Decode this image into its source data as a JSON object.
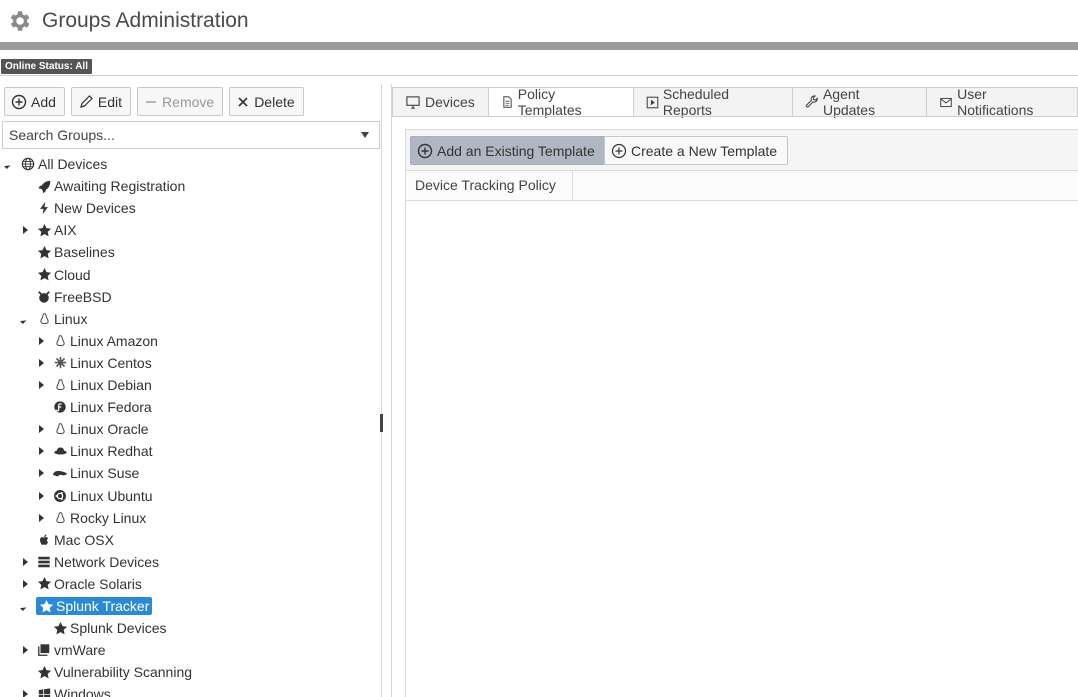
{
  "header": {
    "title": "Groups Administration",
    "icon": "gear-icon"
  },
  "status": {
    "badge": "Online Status: All"
  },
  "toolbar": {
    "add_label": "Add",
    "edit_label": "Edit",
    "remove_label": "Remove",
    "delete_label": "Delete"
  },
  "search": {
    "placeholder": "Search Groups..."
  },
  "tree": [
    {
      "label": "All Devices",
      "icon": "globe-icon",
      "level": 0,
      "expander": "down"
    },
    {
      "label": "Awaiting Registration",
      "icon": "rocket-icon",
      "level": 1,
      "expander": "none"
    },
    {
      "label": "New Devices",
      "icon": "bolt-icon",
      "level": 1,
      "expander": "none"
    },
    {
      "label": "AIX",
      "icon": "star-icon",
      "level": 1,
      "expander": "right"
    },
    {
      "label": "Baselines",
      "icon": "star-icon",
      "level": 1,
      "expander": "none"
    },
    {
      "label": "Cloud",
      "icon": "star-icon",
      "level": 1,
      "expander": "none"
    },
    {
      "label": "FreeBSD",
      "icon": "freebsd-icon",
      "level": 1,
      "expander": "none"
    },
    {
      "label": "Linux",
      "icon": "linux-icon",
      "level": 1,
      "expander": "down"
    },
    {
      "label": "Linux Amazon",
      "icon": "linux-icon",
      "level": 2,
      "expander": "right"
    },
    {
      "label": "Linux Centos",
      "icon": "centos-icon",
      "level": 2,
      "expander": "right"
    },
    {
      "label": "Linux Debian",
      "icon": "linux-icon",
      "level": 2,
      "expander": "right"
    },
    {
      "label": "Linux Fedora",
      "icon": "fedora-icon",
      "level": 2,
      "expander": "none"
    },
    {
      "label": "Linux Oracle",
      "icon": "linux-icon",
      "level": 2,
      "expander": "right"
    },
    {
      "label": "Linux Redhat",
      "icon": "redhat-icon",
      "level": 2,
      "expander": "right"
    },
    {
      "label": "Linux Suse",
      "icon": "suse-icon",
      "level": 2,
      "expander": "right"
    },
    {
      "label": "Linux Ubuntu",
      "icon": "ubuntu-icon",
      "level": 2,
      "expander": "right"
    },
    {
      "label": "Rocky Linux",
      "icon": "linux-icon",
      "level": 2,
      "expander": "right"
    },
    {
      "label": "Mac OSX",
      "icon": "apple-icon",
      "level": 1,
      "expander": "none"
    },
    {
      "label": "Network Devices",
      "icon": "server-icon",
      "level": 1,
      "expander": "right"
    },
    {
      "label": "Oracle Solaris",
      "icon": "star-icon",
      "level": 1,
      "expander": "right"
    },
    {
      "label": "Splunk Tracker",
      "icon": "star-icon",
      "level": 1,
      "expander": "down",
      "selected": true
    },
    {
      "label": "Splunk Devices",
      "icon": "star-icon",
      "level": 2,
      "expander": "none"
    },
    {
      "label": "vmWare",
      "icon": "vmware-icon",
      "level": 1,
      "expander": "right"
    },
    {
      "label": "Vulnerability Scanning",
      "icon": "star-icon",
      "level": 1,
      "expander": "none"
    },
    {
      "label": "Windows",
      "icon": "windows-icon",
      "level": 1,
      "expander": "right"
    }
  ],
  "tabs": [
    {
      "label": "Devices",
      "icon": "monitor-icon",
      "active": false
    },
    {
      "label": "Policy Templates",
      "icon": "document-icon",
      "active": true
    },
    {
      "label": "Scheduled Reports",
      "icon": "play-icon",
      "active": false
    },
    {
      "label": "Agent Updates",
      "icon": "wrench-icon",
      "active": false
    },
    {
      "label": "User Notifications",
      "icon": "envelope-icon",
      "active": false
    }
  ],
  "templates": {
    "add_existing_label": "Add an Existing Template",
    "create_new_label": "Create a New Template",
    "column_header": "Device Tracking Policy"
  },
  "colors": {
    "selected": "#2b8ad6",
    "primary_button": "#b0b7c2",
    "title_rule": "#9a9a9a"
  }
}
